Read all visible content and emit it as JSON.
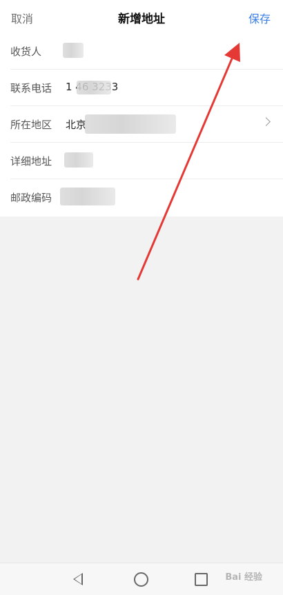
{
  "header": {
    "cancel_label": "取消",
    "title": "新增地址",
    "save_label": "保存"
  },
  "form": {
    "rows": [
      {
        "label": "收货人",
        "value": ""
      },
      {
        "label": "联系电话",
        "value": "1 46 3233"
      },
      {
        "label": "所在地区",
        "value": "北京"
      },
      {
        "label": "详细地址",
        "value": ""
      },
      {
        "label": "邮政编码",
        "value": ""
      }
    ]
  },
  "annotation": {
    "arrow_color": "#e53935"
  },
  "watermark": {
    "text": "Bai 经验"
  }
}
